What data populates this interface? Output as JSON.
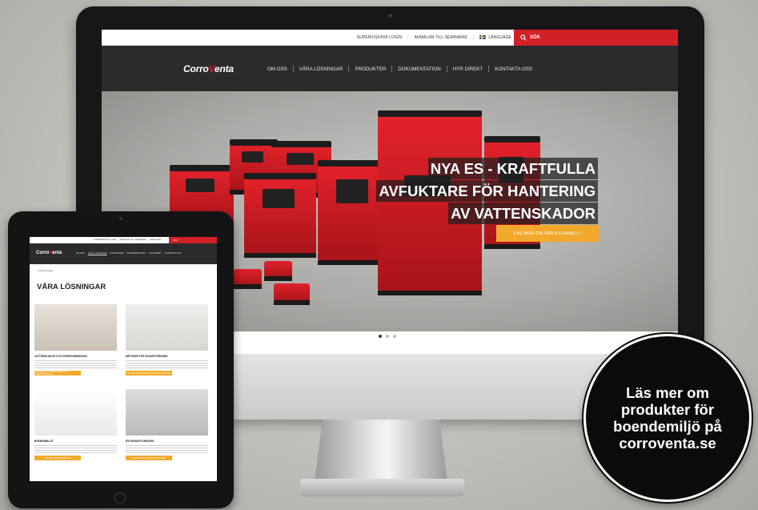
{
  "desktop": {
    "toplinks": [
      "SUPERVISION® LOGIN",
      "ANMÄLAN TILL SEMINARIE",
      "LANGUAGE"
    ],
    "search_label": "SÖK",
    "logo": {
      "pre": "Corro",
      "v": "V",
      "post": "enta"
    },
    "menu": [
      "OM OSS",
      "VÅRA LÖSNINGAR",
      "PRODUKTER",
      "DOKUMENTATION",
      "HYR DIREKT",
      "KONTAKTA OSS"
    ],
    "hero": {
      "lines": [
        "NYA ES - KRAFTFULLA",
        "AVFUKTARE FÖR HANTERING",
        "AV VATTENSKADOR"
      ],
      "button": "LÄS MER OM VÅR ES-FAMILJ  ›"
    }
  },
  "tablet": {
    "toplinks": [
      "SUPERVISION® LOGIN",
      "ANMÄLAN TILL SEMINARIE",
      "LANGUAGE"
    ],
    "search_label": "SÖK",
    "logo": {
      "pre": "Corro",
      "v": "V",
      "post": "enta"
    },
    "menu": [
      "OM OSS",
      "VÅRA LÖSNINGAR",
      "PRODUKTER",
      "DOKUMENTATION",
      "HYR DIREKT",
      "KONTAKTA OSS"
    ],
    "breadcrumb": "Våra lösningar",
    "heading": "VÅRA LÖSNINGAR",
    "cards": [
      {
        "title": "VATTENSKADOR OCH ÖVERSVÄMNINGAR",
        "button": "LÄS MER OM VATTENSKADOR OCH ÖVERSVÄMNINGAR"
      },
      {
        "title": "METODER FÖR SKADETORKNING",
        "button": "LÄS MER OM METODER FÖR SKADETORKNING"
      },
      {
        "title": "BOENDEMILJÖ",
        "button": "LÄS MER OM BOENDEMILJÖ"
      },
      {
        "title": "BYGGNADSTORKNING",
        "button": "LÄS MER OM BYGGNADSTORKNING"
      }
    ]
  },
  "badge": {
    "lines": [
      "Läs mer om",
      "produkter för",
      "boendemiljö på",
      "corroventa.se"
    ]
  },
  "colors": {
    "brand_red": "#d22027",
    "accent_orange": "#f2a92b",
    "nav_dark": "#2b2b2d"
  },
  "icons": [
    "search-icon",
    "sweden-flag-icon",
    "chevron-right-icon",
    "home-icon"
  ]
}
